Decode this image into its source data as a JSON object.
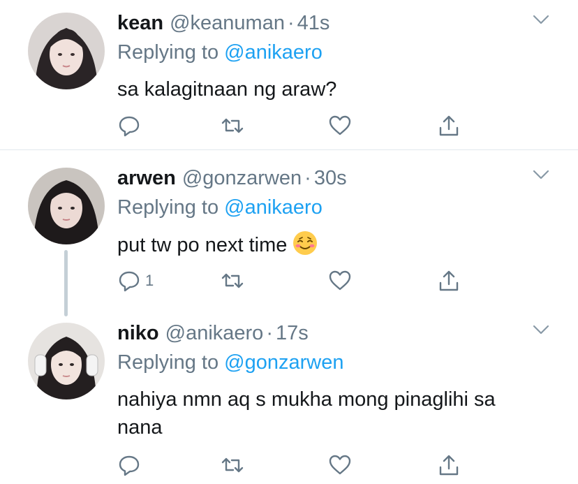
{
  "tweets": [
    {
      "name": "kean",
      "handle": "@keanuman",
      "dot": "·",
      "time": "41s",
      "replying_prefix": "Replying to",
      "replying_to": "@anikaero",
      "text": "sa kalagitnaan ng araw?",
      "reply_count": "",
      "avatar_icon": "avatar-photo"
    },
    {
      "name": "arwen",
      "handle": "@gonzarwen",
      "dot": "·",
      "time": "30s",
      "replying_prefix": "Replying to",
      "replying_to": "@anikaero",
      "text": "put tw po next time",
      "emoji": "relieved-smiling-face-emoji",
      "reply_count": "1",
      "avatar_icon": "avatar-photo"
    },
    {
      "name": "niko",
      "handle": "@anikaero",
      "dot": "·",
      "time": "17s",
      "replying_prefix": "Replying to",
      "replying_to": "@gonzarwen",
      "text": "nahiya nmn aq s mukha mong pinaglihi sa nana",
      "reply_count": "",
      "avatar_icon": "avatar-photo"
    }
  ],
  "colors": {
    "text": "#14171a",
    "secondary": "#657786",
    "mention": "#1da1f2",
    "divider": "#e1e8ed",
    "thread_line": "#c4cfd6"
  },
  "icons": [
    "reply-icon",
    "retweet-icon",
    "like-icon",
    "share-icon",
    "chevron-down-icon"
  ]
}
